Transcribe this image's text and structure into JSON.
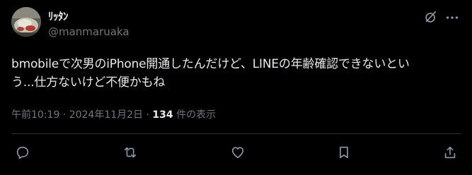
{
  "author": {
    "display_name": "ﾘｯﾀﾝ",
    "handle": "@manmaruaka"
  },
  "tweet": {
    "text": "bmobileで次男のiPhone開通したんだけど、LINEの年齢確認できないとい\nう...仕方ないけど不便かもね"
  },
  "meta": {
    "timestamp": "午前10:19 · 2024年11月2日",
    "separator": " · ",
    "views_count": "134",
    "views_label": " 件の表示"
  },
  "colors": {
    "background": "#000000",
    "text": "#e7e9ea",
    "secondary": "#71767b",
    "icon": "#8b98a5",
    "divider": "#2f3336"
  },
  "icons": {
    "grok": "grok-icon",
    "more": "more-icon",
    "reply": "reply-icon",
    "retweet": "retweet-icon",
    "like": "like-icon",
    "bookmark": "bookmark-icon",
    "share": "share-icon"
  }
}
